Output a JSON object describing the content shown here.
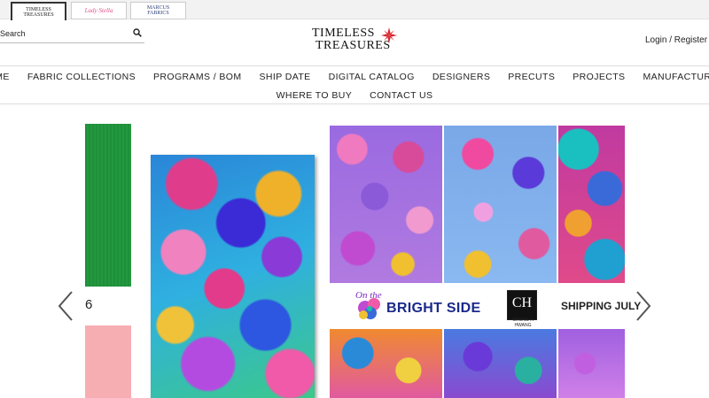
{
  "brands": {
    "tab1_line1": "TIMELESS",
    "tab1_line2": "TREASURES",
    "tab2": "Lady Stella",
    "tab3_line1": "MARCUS",
    "tab3_line2": "FABRICS"
  },
  "search": {
    "placeholder": "Search"
  },
  "logo": {
    "line1": "TIMELESS",
    "line2": "TREASURES"
  },
  "account": {
    "login_label": "Login / Register"
  },
  "nav": {
    "row1": [
      "HOME",
      "FABRIC COLLECTIONS",
      "PROGRAMS / BOM",
      "SHIP DATE",
      "DIGITAL CATALOG",
      "DESIGNERS",
      "PRECUTS",
      "PROJECTS",
      "MANUFACTURING"
    ],
    "row2": [
      "WHERE TO BUY",
      "CONTACT US"
    ]
  },
  "slider": {
    "slide_number": "6",
    "banner_title_script": "On the",
    "banner_title_bold": "BRIGHT SIDE",
    "designer_initials": "CH",
    "designer_name": "CHONG-A HWANG",
    "ship_text": "SHIPPING JULY"
  },
  "colors": {
    "logo_star": "#d8272e",
    "banner_navy": "#1a2a8a",
    "swatch_green": "#1f8f3a",
    "swatch_pink": "#f7aeb2"
  }
}
